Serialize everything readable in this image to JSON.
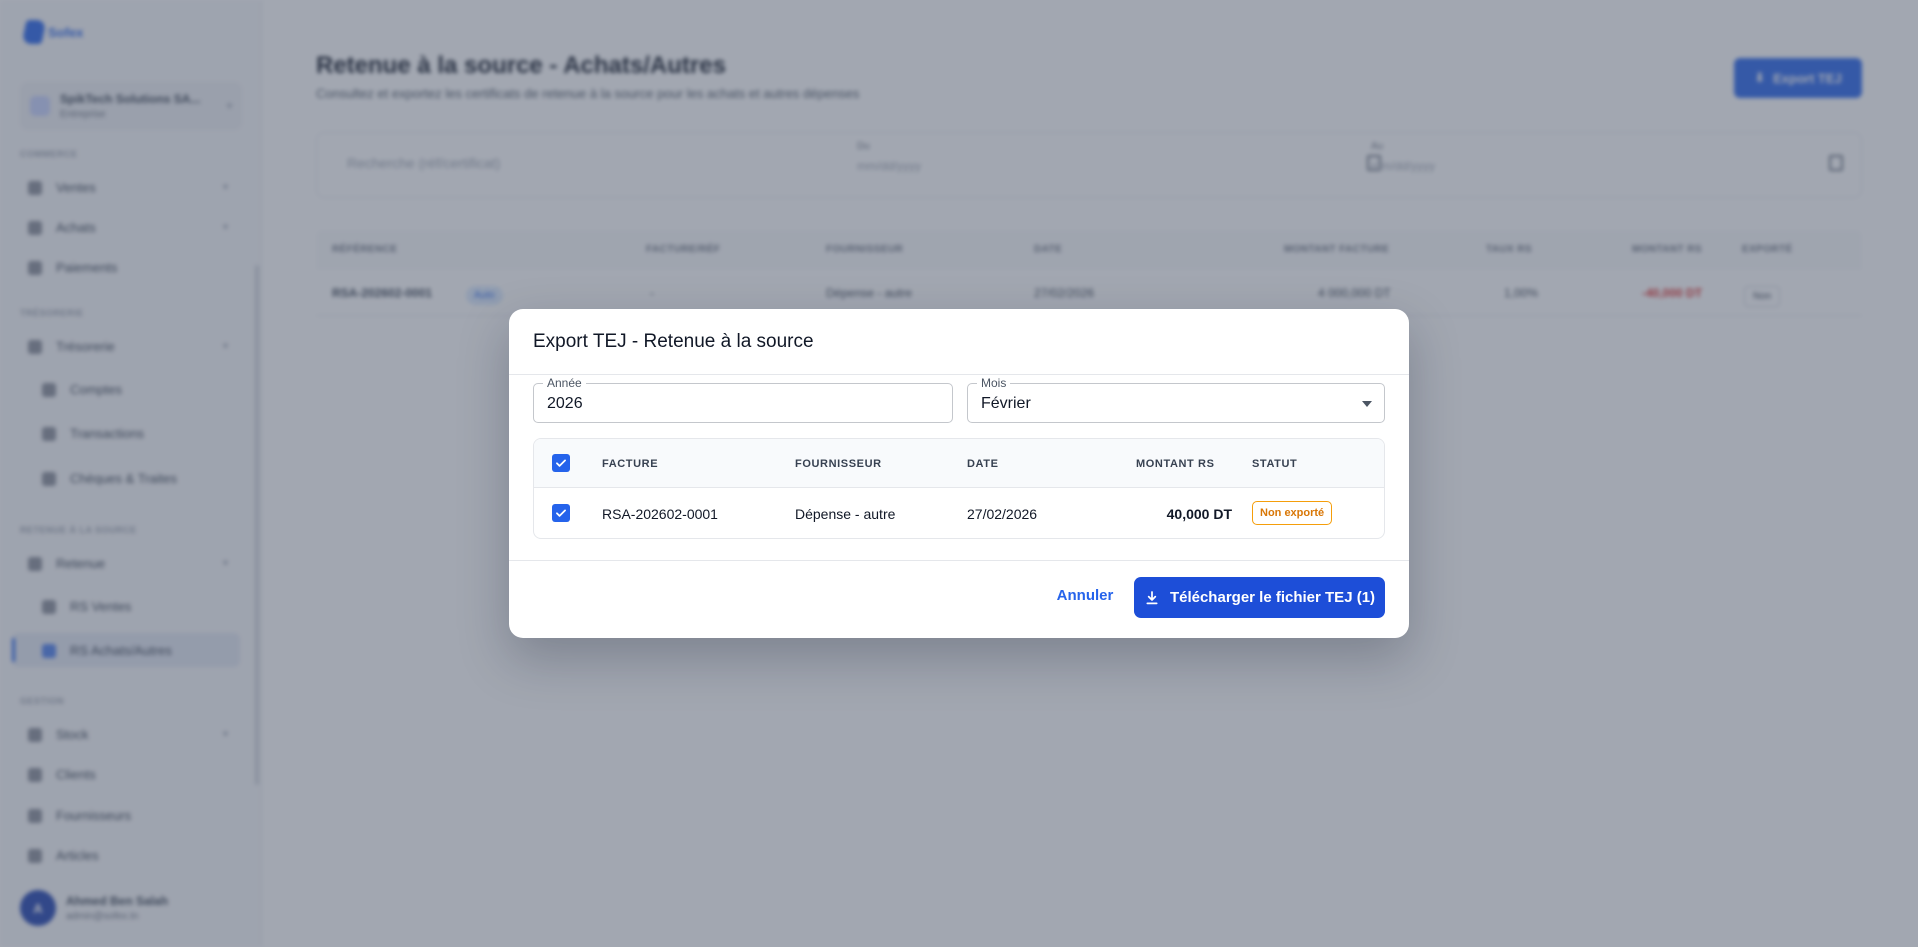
{
  "sidebar": {
    "brand": "Sofex",
    "company": {
      "name": "SpikTech Solutions SA...",
      "role": "Entreprise"
    },
    "sections": [
      "COMMERCE",
      "TRÉSORERIE",
      "RETENUE À LA SOURCE",
      "GESTION"
    ],
    "items": [
      "Ventes",
      "Achats",
      "Paiements",
      "Trésorerie",
      "Comptes",
      "Transactions",
      "Chèques & Traites",
      "Retenue",
      "RS Ventes",
      "RS Achats/Autres",
      "Stock",
      "Clients",
      "Fournisseurs",
      "Articles"
    ],
    "user": {
      "initial": "A",
      "name": "Ahmed Ben Salah",
      "email": "admin@sofex.tn"
    }
  },
  "page": {
    "title": "Retenue à la source - Achats/Autres",
    "subtitle": "Consultez et exportez les certificats de retenue à la source pour les achats et autres dépenses",
    "export_button": "Export TEJ",
    "search_placeholder": "Recherche (réf/certificat)",
    "from_label": "Du",
    "to_label": "Au",
    "date_placeholder": "mm/dd/yyyy"
  },
  "bg_table": {
    "columns": [
      "RÉFÉRENCE",
      "FACTURE/RÉF",
      "FOURNISSEUR",
      "DATE",
      "MONTANT FACTURE",
      "TAUX RS",
      "MONTANT RS",
      "EXPORTÉ"
    ],
    "row": {
      "ref": "RSA-202602-0001",
      "tag": "Auto",
      "facture": "-",
      "fournisseur": "Dépense - autre",
      "date": "27/02/2026",
      "montant": "4 000,000 DT",
      "taux": "1,00%",
      "montant_rs": "-40,000 DT",
      "exporte": "Non"
    }
  },
  "modal": {
    "title": "Export TEJ - Retenue à la source",
    "year_label": "Année",
    "year_value": "2026",
    "month_label": "Mois",
    "month_value": "Février",
    "columns": {
      "facture": "FACTURE",
      "fournisseur": "FOURNISSEUR",
      "date": "DATE",
      "montant": "MONTANT RS",
      "statut": "STATUT"
    },
    "rows": [
      {
        "facture": "RSA-202602-0001",
        "fournisseur": "Dépense - autre",
        "date": "27/02/2026",
        "montant": "40,000 DT",
        "statut": "Non exporté"
      }
    ],
    "cancel_label": "Annuler",
    "download_label": "Télécharger le fichier TEJ (1)"
  },
  "colors": {
    "accent": "#1d4ed8",
    "status_warning": "#d97706",
    "overlay": "rgba(70,80,100,0.5)"
  },
  "icons": {
    "checkbox": "check-icon",
    "download": "download-icon",
    "select": "caret-down-icon"
  }
}
